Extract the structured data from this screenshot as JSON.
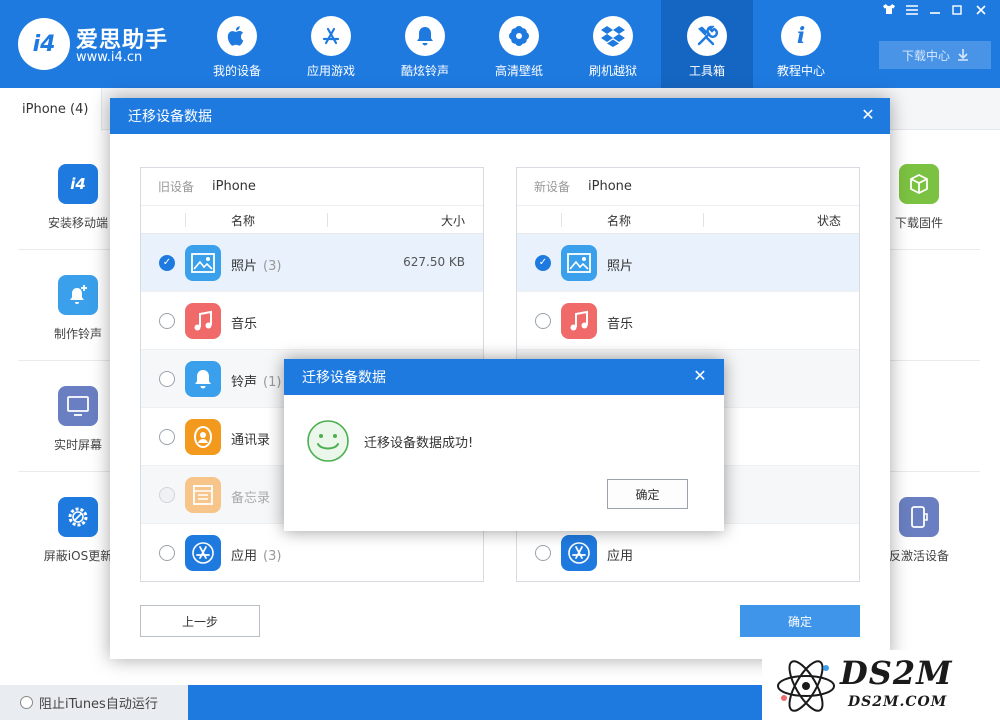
{
  "app": {
    "logo_text": "i4",
    "brand_name": "爱思助手",
    "brand_url": "www.i4.cn"
  },
  "nav": [
    {
      "label": "我的设备",
      "icon": "apple-icon"
    },
    {
      "label": "应用游戏",
      "icon": "app-store-icon"
    },
    {
      "label": "酷炫铃声",
      "icon": "bell-icon"
    },
    {
      "label": "高清壁纸",
      "icon": "flower-icon"
    },
    {
      "label": "刷机越狱",
      "icon": "dropbox-icon"
    },
    {
      "label": "工具箱",
      "icon": "tools-icon",
      "active": true
    },
    {
      "label": "教程中心",
      "icon": "info-icon"
    }
  ],
  "window": {
    "download_center": "下载中心"
  },
  "device_tab": "iPhone (4)",
  "tools": {
    "left": [
      "安装移动端",
      "制作铃声",
      "实时屏幕",
      "屏蔽iOS更新"
    ],
    "right": [
      "下载固件",
      "反激活设备"
    ]
  },
  "bottom": {
    "itunes_label": "阻止iTunes自动运行"
  },
  "modal": {
    "title": "迁移设备数据",
    "old_device": {
      "label": "旧设备",
      "name": "iPhone",
      "col_name": "名称",
      "col_size": "大小",
      "rows": [
        {
          "name": "照片",
          "count": "(3)",
          "size": "627.50 KB",
          "checked": true
        },
        {
          "name": "音乐",
          "count": "",
          "size": "",
          "checked": false
        },
        {
          "name": "铃声",
          "count": "(1)",
          "size": "",
          "checked": false
        },
        {
          "name": "通讯录",
          "count": "",
          "size": "",
          "checked": false
        },
        {
          "name": "备忘录",
          "count": "",
          "size": "",
          "checked": false,
          "disabled": true
        },
        {
          "name": "应用",
          "count": "(3)",
          "size": "",
          "checked": false
        }
      ]
    },
    "new_device": {
      "label": "新设备",
      "name": "iPhone",
      "col_name": "名称",
      "col_status": "状态",
      "rows": [
        {
          "name": "照片",
          "checked": true
        },
        {
          "name": "音乐",
          "checked": false
        },
        {
          "name": "应用",
          "checked": false
        }
      ]
    },
    "prev_button": "上一步",
    "ok_button": "确定"
  },
  "dialog": {
    "title": "迁移设备数据",
    "message": "迁移设备数据成功!",
    "ok_button": "确定"
  },
  "watermark": {
    "big": "DS2M",
    "small": "DS2M.COM"
  },
  "colors": {
    "primary": "#1f7ae0",
    "selected_row": "#e8f1fc",
    "success": "#4caf50"
  }
}
